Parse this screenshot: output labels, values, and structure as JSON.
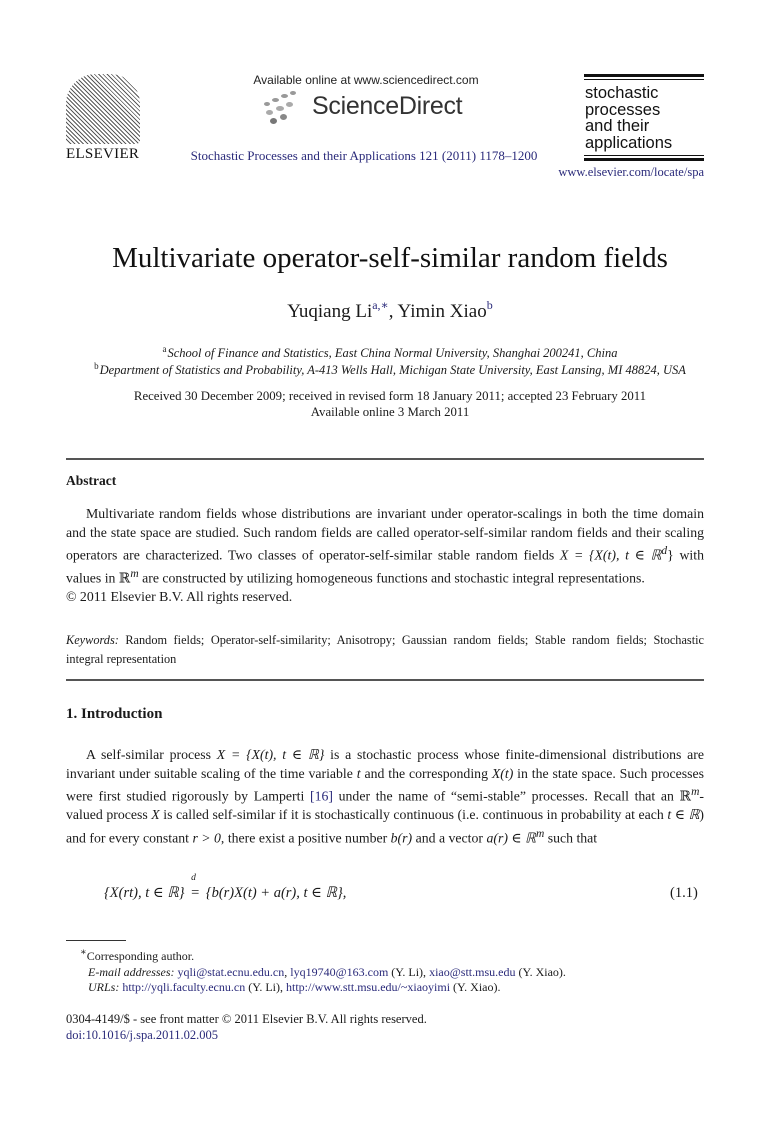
{
  "header": {
    "publisher_logo": "ELSEVIER",
    "available_online": "Available online at www.sciencedirect.com",
    "sciencedirect_logo": "ScienceDirect",
    "journal_citation": "Stochastic Processes and their Applications 121 (2011) 1178–1200",
    "journal_logo_lines": [
      "stochastic",
      "processes",
      "and their",
      "applications"
    ],
    "journal_url": "www.elsevier.com/locate/spa"
  },
  "article": {
    "title": "Multivariate operator-self-similar random fields",
    "authors": [
      {
        "name": "Yuqiang Li",
        "marks": "a,∗"
      },
      {
        "name": "Yimin Xiao",
        "marks": "b"
      }
    ],
    "author_separator": ", ",
    "affiliations": [
      {
        "mark": "a",
        "text": "School of Finance and Statistics, East China Normal University, Shanghai 200241, China"
      },
      {
        "mark": "b",
        "text": "Department of Statistics and Probability, A-413 Wells Hall, Michigan State University, East Lansing, MI 48824, USA"
      }
    ],
    "received": "Received 30 December 2009; received in revised form 18 January 2011; accepted 23 February 2011",
    "available": "Available online 3 March 2011"
  },
  "abstract": {
    "heading": "Abstract",
    "text_1": "Multivariate random fields whose distributions are invariant under operator-scalings in both the time domain and the state space are studied. Such random fields are called operator-self-similar random fields and their scaling operators are characterized. Two classes of operator-self-similar stable random fields ",
    "math_1": "X = {X(t), t ∈ ℝ",
    "math_1_sup": "d",
    "math_1_close": "}",
    "text_2": " with values in ",
    "math_2": "ℝ",
    "math_2_sup": "m",
    "text_3": " are constructed by utilizing homogeneous functions and stochastic integral representations.",
    "copyright": "© 2011 Elsevier B.V. All rights reserved."
  },
  "keywords": {
    "label": "Keywords:",
    "text": "Random fields; Operator-self-similarity; Anisotropy; Gaussian random fields; Stable random fields; Stochastic integral representation"
  },
  "section_1": {
    "heading": "1.  Introduction",
    "p1_a": "A self-similar process ",
    "p1_math_a": "X = {X(t), t ∈ ℝ}",
    "p1_b": " is a stochastic process whose finite-dimensional distributions are invariant under suitable scaling of the time variable ",
    "p1_t": "t",
    "p1_c": " and the corresponding ",
    "p1_xt": "X(t)",
    "p1_d": " in the state space. Such processes were first studied rigorously by Lamperti ",
    "p1_ref": "[16]",
    "p1_e": " under the name of “semi-stable” processes. Recall that an ",
    "p1_rm": "ℝ",
    "p1_rm_sup": "m",
    "p1_f": "-valued process ",
    "p1_x": "X",
    "p1_g": " is called self-similar if it is stochastically continuous (i.e. continuous in probability at each ",
    "p1_tin": "t ∈ ℝ",
    "p1_h": ") and for every constant ",
    "p1_r": "r > 0",
    "p1_i": ", there exist a positive number ",
    "p1_br": "b(r)",
    "p1_j": " and a vector ",
    "p1_ar": "a(r) ∈ ℝ",
    "p1_ar_sup": "m",
    "p1_k": " such that",
    "equation_left": "{X(rt), t ∈ ℝ}",
    "equation_rel_top": "d",
    "equation_rel": "=",
    "equation_right": "{b(r)X(t) + a(r), t ∈ ℝ},",
    "equation_number": "(1.1)"
  },
  "footnotes": {
    "corresponding": "Corresponding author.",
    "corresponding_mark": "∗",
    "email_label": "E-mail addresses:",
    "email_1": "yqli@stat.ecnu.edu.cn",
    "email_2": "lyq19740@163.com",
    "email_owner_1": " (Y. Li), ",
    "email_3": "xiao@stt.msu.edu",
    "email_owner_2": " (Y. Xiao).",
    "url_label": "URLs:",
    "url_1": "http://yqli.faculty.ecnu.cn",
    "url_owner_1": " (Y. Li), ",
    "url_2": "http://www.stt.msu.edu/~xiaoyimi",
    "url_owner_2": " (Y. Xiao)."
  },
  "bottom": {
    "issn_line": "0304-4149/$ - see front matter © 2011 Elsevier B.V. All rights reserved.",
    "doi": "doi:10.1016/j.spa.2011.02.005"
  },
  "colors": {
    "link": "#2a2a7a",
    "rule": "#555555"
  }
}
